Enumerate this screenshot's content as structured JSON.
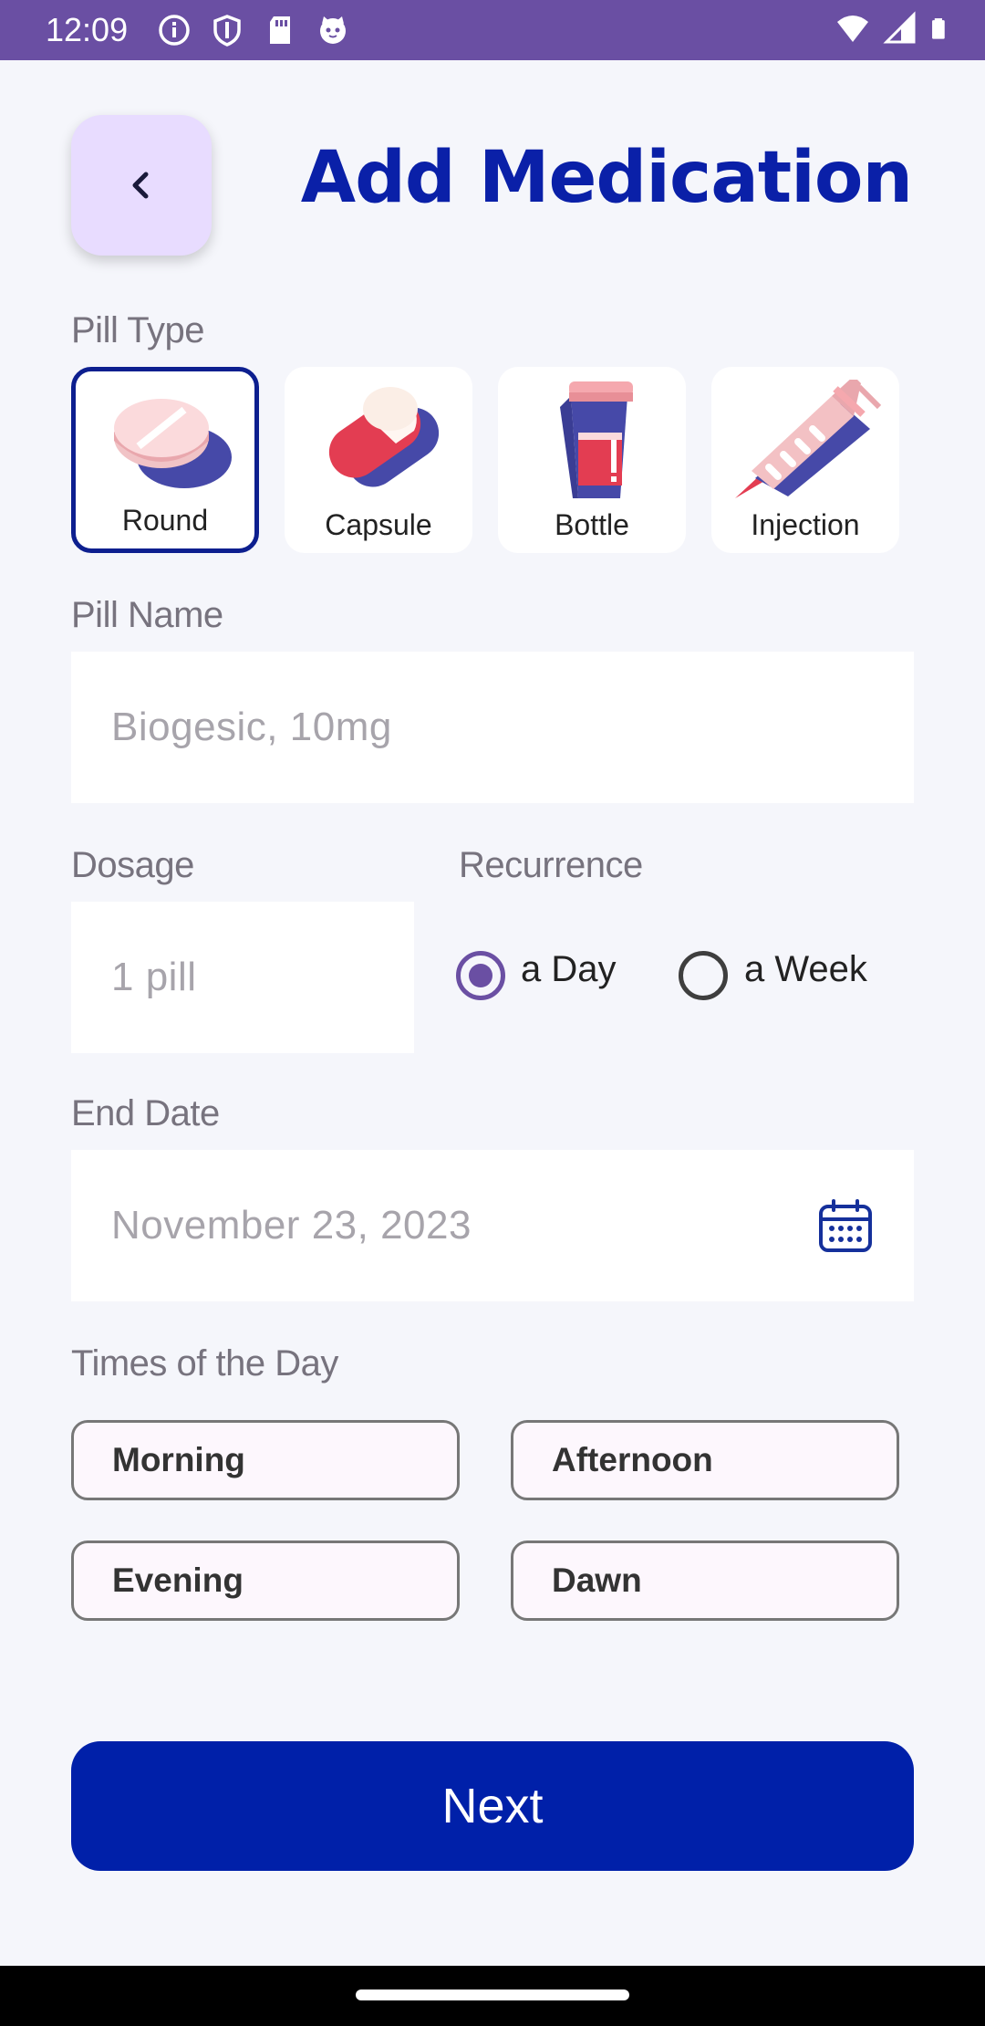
{
  "status_bar": {
    "time": "12:09",
    "left_icons": [
      "info-icon",
      "shield-icon",
      "sd-card-icon",
      "cat-icon"
    ],
    "right_icons": [
      "wifi-icon",
      "signal-icon",
      "battery-icon"
    ]
  },
  "header": {
    "back_icon": "chevron-left-icon",
    "title": "Add Medication"
  },
  "pill_type": {
    "label": "Pill Type",
    "options": [
      {
        "label": "Round",
        "icon": "round-pill-icon",
        "selected": true
      },
      {
        "label": "Capsule",
        "icon": "capsule-icon",
        "selected": false
      },
      {
        "label": "Bottle",
        "icon": "bottle-icon",
        "selected": false
      },
      {
        "label": "Injection",
        "icon": "syringe-icon",
        "selected": false
      }
    ]
  },
  "pill_name": {
    "label": "Pill Name",
    "placeholder": "Biogesic, 10mg"
  },
  "dosage": {
    "label": "Dosage",
    "placeholder": "1 pill"
  },
  "recurrence": {
    "label": "Recurrence",
    "options": [
      {
        "label": "a Day",
        "checked": true
      },
      {
        "label": "a Week",
        "checked": false
      }
    ]
  },
  "end_date": {
    "label": "End Date",
    "value": "November 23, 2023",
    "icon": "calendar-icon"
  },
  "times_of_day": {
    "label": "Times of the Day",
    "options": [
      "Morning",
      "Afternoon",
      "Evening",
      "Dawn"
    ]
  },
  "next_button": {
    "label": "Next"
  },
  "colors": {
    "primary": "#0020a9",
    "accent": "#6a4fa3",
    "title": "#0a20a8",
    "back_button_bg": "#e8dcff"
  }
}
